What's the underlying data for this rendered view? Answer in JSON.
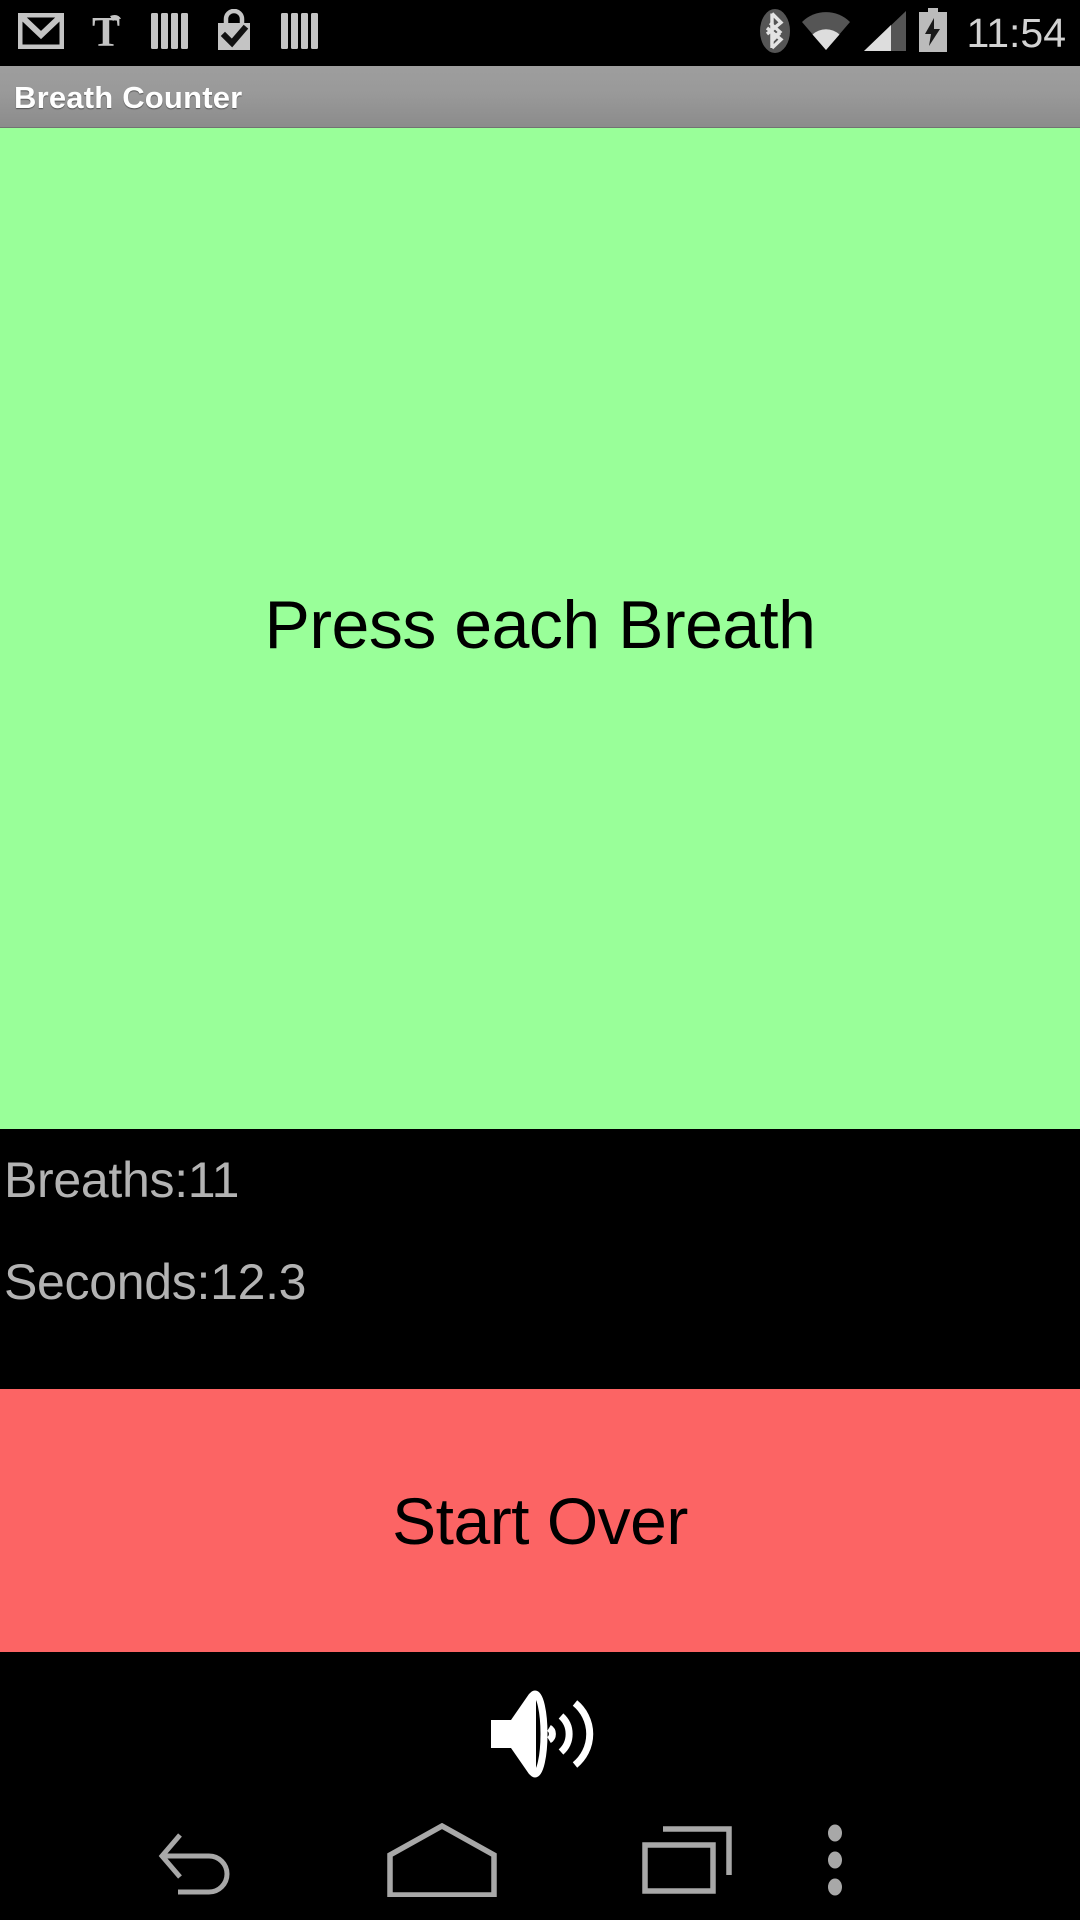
{
  "status_bar": {
    "notification_icons": [
      {
        "name": "gmail-icon",
        "label": "Gmail"
      },
      {
        "name": "nytimes-icon",
        "label": "NYTimes"
      },
      {
        "name": "books-icon",
        "label": "Books"
      },
      {
        "name": "play-store-icon",
        "label": "Play Store"
      },
      {
        "name": "books-icon-2",
        "label": "Books"
      }
    ],
    "system_icons": [
      {
        "name": "bluetooth-icon",
        "label": "Bluetooth"
      },
      {
        "name": "wifi-icon",
        "label": "Wi-Fi"
      },
      {
        "name": "cellular-signal-icon",
        "label": "Cellular signal"
      },
      {
        "name": "battery-charging-icon",
        "label": "Battery charging"
      }
    ],
    "clock": "11:54",
    "text_color": "#d2d2d2",
    "background": "#000000"
  },
  "app_bar": {
    "title": "Breath Counter",
    "background_top": "#9e9e9e",
    "background_bottom": "#8b8b8b",
    "title_color": "#ffffff"
  },
  "breath_area": {
    "prompt": "Press each Breath",
    "background": "#99ff99",
    "text_color": "#000000"
  },
  "stats": {
    "breaths_label": "Breaths:11",
    "seconds_label": "Seconds:12.3",
    "breaths_count": 11,
    "seconds_elapsed": 12.3,
    "text_color": "#b3b3b3",
    "background": "#000000"
  },
  "start_over": {
    "label": "Start Over",
    "background": "#fc6464",
    "text_color": "#000000"
  },
  "sound": {
    "icon_name": "speaker-volume-icon",
    "icon_color": "#ffffff"
  },
  "nav_bar": {
    "back_label": "Back",
    "home_label": "Home",
    "recents_label": "Recent apps",
    "menu_label": "More options",
    "icon_color": "#a8a8a8",
    "background": "#000000"
  }
}
